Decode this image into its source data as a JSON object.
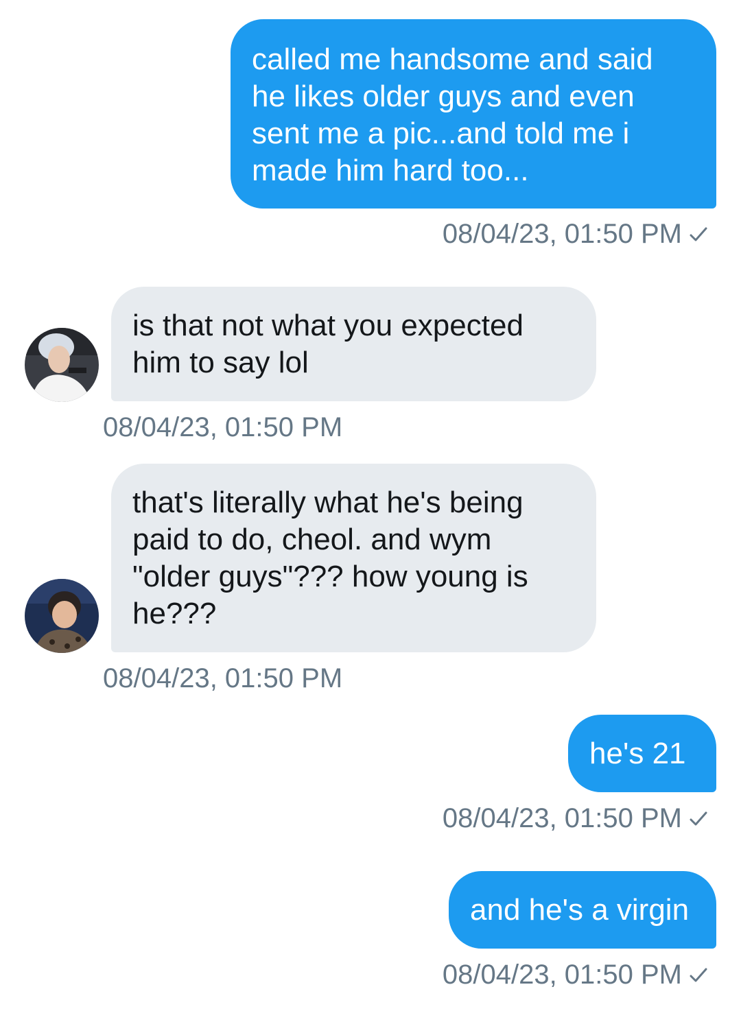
{
  "messages": [
    {
      "direction": "sent",
      "text": "called me handsome and said\nhe likes older guys and even\nsent me a pic...and told me i\nmade him hard too...",
      "timestamp": "08/04/23, 01:50 PM",
      "read_icon": "check-icon"
    },
    {
      "direction": "received",
      "text": "is that not what you expected\nhim to say lol",
      "timestamp": "08/04/23, 01:50 PM",
      "avatar_icon": "avatar-image"
    },
    {
      "direction": "received",
      "text": "that's literally what he's being\npaid to do, cheol. and wym\n\"older guys\"??? how young is\nhe???",
      "timestamp": "08/04/23, 01:50 PM",
      "avatar_icon": "avatar-image"
    },
    {
      "direction": "sent",
      "text": "he's 21",
      "timestamp": "08/04/23, 01:50 PM",
      "read_icon": "check-icon"
    },
    {
      "direction": "sent",
      "text": "and he's a virgin",
      "timestamp": "08/04/23, 01:50 PM",
      "read_icon": "check-icon"
    }
  ],
  "colors": {
    "sent_bubble": "#1d9bf0",
    "received_bubble": "#e7ebef",
    "timestamp": "#657786"
  }
}
